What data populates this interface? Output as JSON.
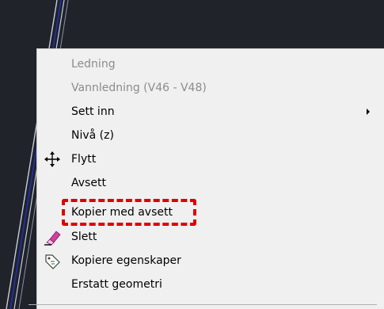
{
  "context_menu": {
    "items": [
      {
        "label": "Ledning",
        "disabled": true
      },
      {
        "label": "Vannledning (V46 - V48)",
        "disabled": true
      },
      {
        "label": "Sett inn",
        "submenu": true
      },
      {
        "label": "Nivå (z)"
      },
      {
        "label": "Flytt",
        "icon": "move-icon"
      },
      {
        "label": "Avsett"
      },
      {
        "label": "Kopier med avsett",
        "highlighted": true
      },
      {
        "label": "Slett",
        "icon": "eraser-icon"
      },
      {
        "label": "Kopiere egenskaper",
        "icon": "tag-icon"
      },
      {
        "label": "Erstatt geometri"
      }
    ]
  },
  "colors": {
    "menu_background": "#f0f0f0",
    "disabled_text": "#8c8c8c",
    "highlight": "#e00000",
    "viewport_background": "#202329"
  }
}
